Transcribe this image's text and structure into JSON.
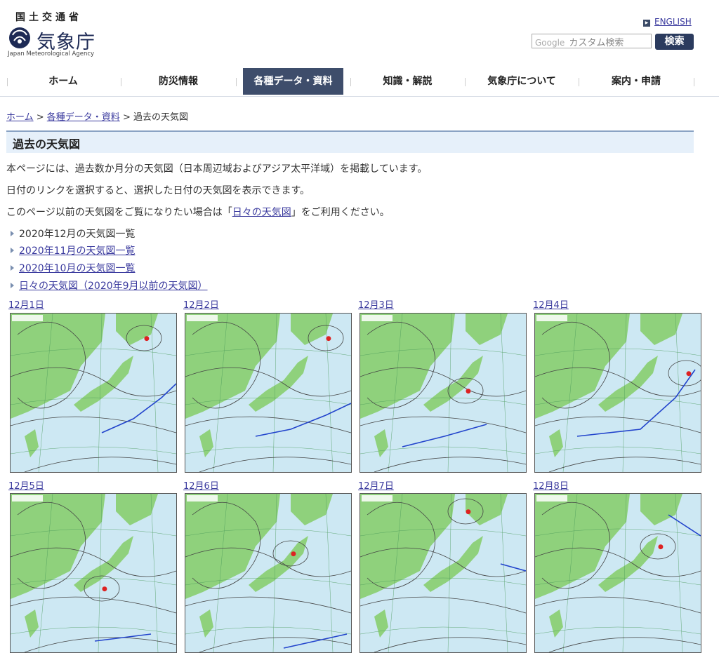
{
  "header": {
    "ministry": "国土交通省",
    "agency_name": "気象庁",
    "agency_en": "Japan Meteorological Agency",
    "english_link": "ENGLISH",
    "search_placeholder": "カスタム検索",
    "search_brand": "Google",
    "search_button": "検索"
  },
  "nav": {
    "items": [
      {
        "label": "ホーム"
      },
      {
        "label": "防災情報"
      },
      {
        "label": "各種データ・資料"
      },
      {
        "label": "知識・解説"
      },
      {
        "label": "気象庁について"
      },
      {
        "label": "案内・申請"
      }
    ]
  },
  "breadcrumb": {
    "home": "ホーム",
    "sep1": " > ",
    "data": "各種データ・資料",
    "sep2": " > ",
    "current": "過去の天気図"
  },
  "page": {
    "title": "過去の天気図",
    "para1": "本ページには、過去数か月分の天気図（日本周辺域およびアジア太平洋域）を掲載しています。",
    "para2": "日付のリンクを選択すると、選択した日付の天気図を表示できます。",
    "para3_before": "このページ以前の天気図をご覧になりたい場合は「",
    "para3_link": "日々の天気図",
    "para3_after": "」をご利用ください。"
  },
  "links": [
    {
      "label": "2020年12月の天気図一覧"
    },
    {
      "label": "2020年11月の天気図一覧"
    },
    {
      "label": "2020年10月の天気図一覧"
    },
    {
      "label": "日々の天気図（2020年9月以前の天気図）"
    }
  ],
  "maps": [
    {
      "date": "12月1日"
    },
    {
      "date": "12月2日"
    },
    {
      "date": "12月3日"
    },
    {
      "date": "12月4日"
    },
    {
      "date": "12月5日"
    },
    {
      "date": "12月6日"
    },
    {
      "date": "12月7日"
    },
    {
      "date": "12月8日"
    }
  ],
  "colors": {
    "nav_active": "#3e4d6b",
    "title_bar": "#e6f0fa",
    "link": "#3a3a9e",
    "land": "#8fd17c",
    "sea": "#cde8f3"
  }
}
